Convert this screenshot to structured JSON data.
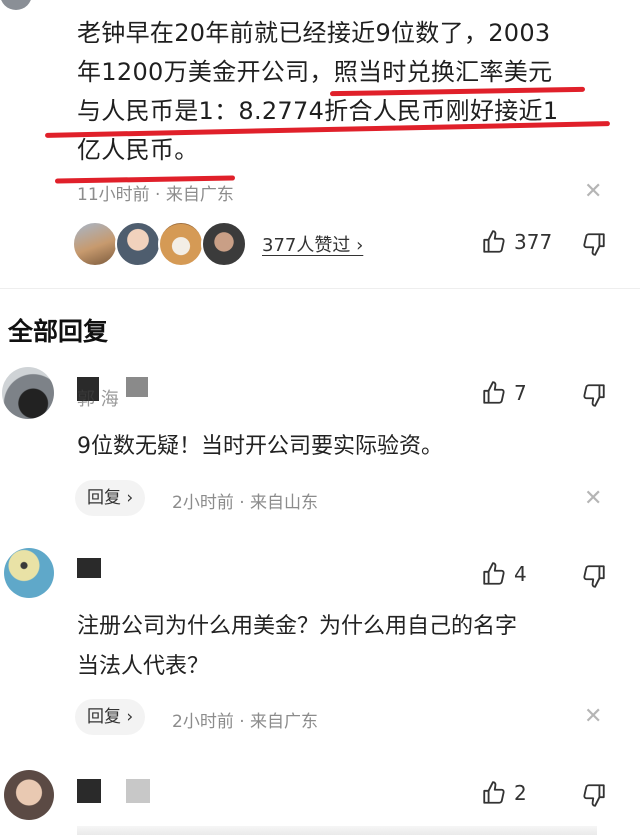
{
  "top_comment": {
    "lines": [
      "老钟早在20年前就已经接近9位数了，2003",
      "年1200万美金开公司，",
      "照当时兑换汇率美元",
      "与人民币是1：8.2774折合人民币刚好接近1",
      "亿人民币。"
    ],
    "meta": "11小时前 · 来自广东",
    "liked_by": "377人赞过 ›",
    "like_count": "377",
    "highlight_color": "#e0202a"
  },
  "section": {
    "title": "全部回复"
  },
  "replies": [
    {
      "username": "郭 海",
      "like_count": "7",
      "text": "9位数无疑！当时开公司要实际验资。",
      "reply_label": "回复 ›",
      "meta": "2小时前 · 来自山东"
    },
    {
      "username": "",
      "like_count": "4",
      "text_lines": [
        "注册公司为什么用美金？为什么用自己的名字",
        "当法人代表？"
      ],
      "reply_label": "回复 ›",
      "meta": "2小时前 · 来自广东"
    },
    {
      "username": "",
      "like_count": "2"
    }
  ],
  "icons": {
    "like": "thumbs-up-icon",
    "dislike": "thumbs-down-icon",
    "close": "close-icon"
  }
}
